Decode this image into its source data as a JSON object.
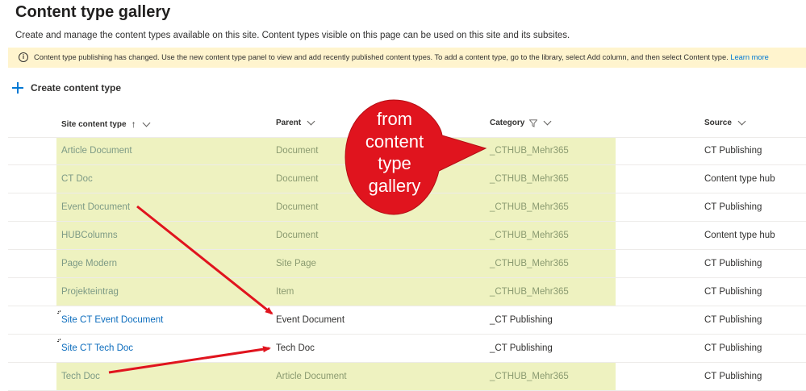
{
  "page": {
    "title": "Content type gallery",
    "subtitle": "Create and manage the content types available on this site. Content types visible on this page can be used on this site and its subsites."
  },
  "banner": {
    "icon": "info-icon",
    "text": "Content type publishing has changed. Use the new content type panel to view and add recently published content types. To add a content type, go to the library, select Add column, and then select Content type.",
    "link": "Learn more"
  },
  "toolbar": {
    "create_label": "Create content type"
  },
  "table": {
    "headers": {
      "name": "Site content type",
      "parent": "Parent",
      "category": "Category",
      "source": "Source"
    },
    "rows": [
      {
        "name": "Article Document",
        "parent": "Document",
        "category": "_CTHUB_Mehr365",
        "source": "CT Publishing",
        "style": "hub"
      },
      {
        "name": "CT Doc",
        "parent": "Document",
        "category": "_CTHUB_Mehr365",
        "source": "Content type hub",
        "style": "hub"
      },
      {
        "name": "Event Document",
        "parent": "Document",
        "category": "_CTHUB_Mehr365",
        "source": "CT Publishing",
        "style": "hub"
      },
      {
        "name": "HUBColumns",
        "parent": "Document",
        "category": "_CTHUB_Mehr365",
        "source": "Content type hub",
        "style": "hub"
      },
      {
        "name": "Page Modern",
        "parent": "Site Page",
        "category": "_CTHUB_Mehr365",
        "source": "CT Publishing",
        "style": "hub"
      },
      {
        "name": "Projekteintrag",
        "parent": "Item",
        "category": "_CTHUB_Mehr365",
        "source": "CT Publishing",
        "style": "hub"
      },
      {
        "name": "Site CT Event Document",
        "parent": "Event Document",
        "category": "_CT Publishing",
        "source": "CT Publishing",
        "style": "site"
      },
      {
        "name": "Site CT Tech Doc",
        "parent": "Tech Doc",
        "category": "_CT Publishing",
        "source": "CT Publishing",
        "style": "site"
      },
      {
        "name": "Tech Doc",
        "parent": "Article Document",
        "category": "_CTHUB_Mehr365",
        "source": "CT Publishing",
        "style": "hub"
      }
    ]
  },
  "annotation": {
    "bubble_lines": [
      "from",
      "content",
      "type",
      "gallery"
    ],
    "color": "#e0141e"
  },
  "colors": {
    "highlight": "#eef2c0",
    "banner": "#fff4ce",
    "accent": "#0078d4"
  }
}
